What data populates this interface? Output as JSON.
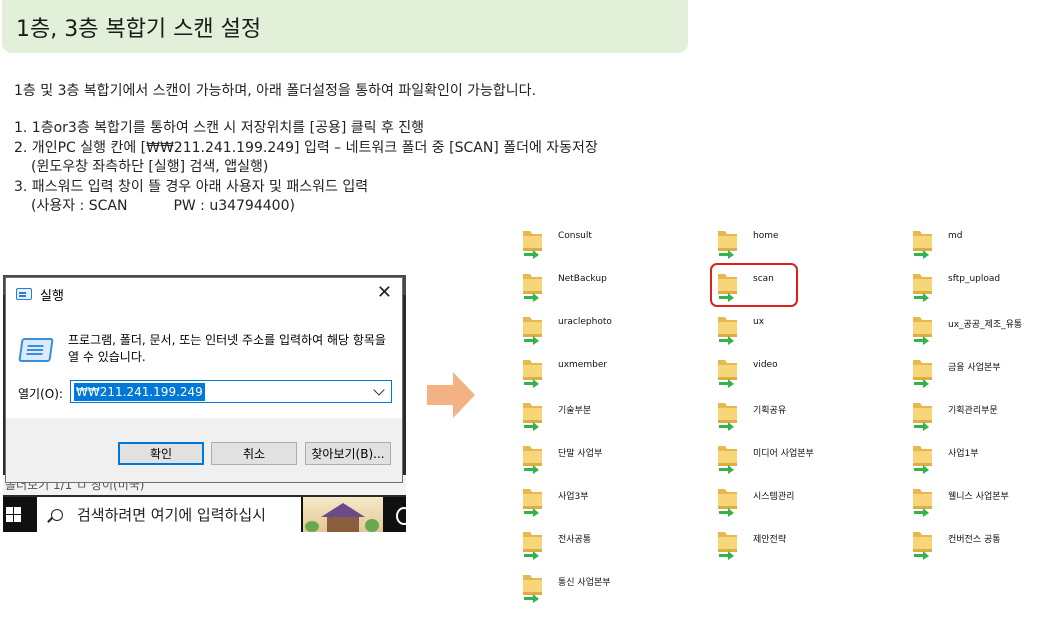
{
  "title": "1층, 3층 복합기 스캔 설정",
  "intro": "1층 및 3층 복합기에서 스캔이 가능하며, 아래 폴더설정을 통하여 파일확인이 가능합니다.",
  "steps": {
    "s1": "1. 1층or3층 복합기를 통하여 스캔 시 저장위치를 [공용] 클릭 후 진행",
    "s2": "2. 개인PC 실행 칸에 [₩₩211.241.199.249] 입력 – 네트워크 폴더 중 [SCAN] 폴더에 자동저장",
    "s2b": "(윈도우창 좌측하단 [실행] 검색, 앱실행)",
    "s3": "3. 패스워드 입력 창이 뜰 경우 아래 사용자 및 패스워드 입력",
    "s3b_user": "(사용자 : SCAN",
    "s3b_pw": "PW : u34794400)"
  },
  "run_dialog": {
    "title": "실행",
    "close_glyph": "✕",
    "description": "프로그램, 폴더, 문서, 또는 인터넷 주소를 입력하여 해당 항목을 열 수 있습니다.",
    "open_label": "열기(O):",
    "input_value": "₩₩211.241.199.249",
    "ok_label": "확인",
    "cancel_label": "취소",
    "browse_label": "찾아보기(B)..."
  },
  "background_window_text": "폴더보기 1/1      ㅁ      창이(미국)",
  "taskbar": {
    "search_placeholder": "검색하려면 여기에 입력하십시"
  },
  "arrow_color": "#f4b183",
  "highlight_color": "#e0201f",
  "folders": [
    {
      "col": 0,
      "row": 0,
      "name": "Consult"
    },
    {
      "col": 1,
      "row": 0,
      "name": "home"
    },
    {
      "col": 2,
      "row": 0,
      "name": "md"
    },
    {
      "col": 0,
      "row": 1,
      "name": "NetBackup"
    },
    {
      "col": 1,
      "row": 1,
      "name": "scan"
    },
    {
      "col": 2,
      "row": 1,
      "name": "sftp_upload"
    },
    {
      "col": 0,
      "row": 2,
      "name": "uraclephoto"
    },
    {
      "col": 1,
      "row": 2,
      "name": "ux"
    },
    {
      "col": 2,
      "row": 2,
      "name": "ux_공공_제조_유통"
    },
    {
      "col": 0,
      "row": 3,
      "name": "uxmember"
    },
    {
      "col": 1,
      "row": 3,
      "name": "video"
    },
    {
      "col": 2,
      "row": 3,
      "name": "금융 사업본부"
    },
    {
      "col": 0,
      "row": 4,
      "name": "기술부분"
    },
    {
      "col": 1,
      "row": 4,
      "name": "기획공유"
    },
    {
      "col": 2,
      "row": 4,
      "name": "기획관리부문"
    },
    {
      "col": 0,
      "row": 5,
      "name": "단말 사업부"
    },
    {
      "col": 1,
      "row": 5,
      "name": "미디어 사업본부"
    },
    {
      "col": 2,
      "row": 5,
      "name": "사업1부"
    },
    {
      "col": 0,
      "row": 6,
      "name": "사업3부"
    },
    {
      "col": 1,
      "row": 6,
      "name": "시스템관리"
    },
    {
      "col": 2,
      "row": 6,
      "name": "웰니스 사업본부"
    },
    {
      "col": 0,
      "row": 7,
      "name": "전사공통"
    },
    {
      "col": 1,
      "row": 7,
      "name": "제안전략"
    },
    {
      "col": 2,
      "row": 7,
      "name": "컨버전스 공통"
    },
    {
      "col": 0,
      "row": 8,
      "name": "통신 사업본부"
    }
  ]
}
